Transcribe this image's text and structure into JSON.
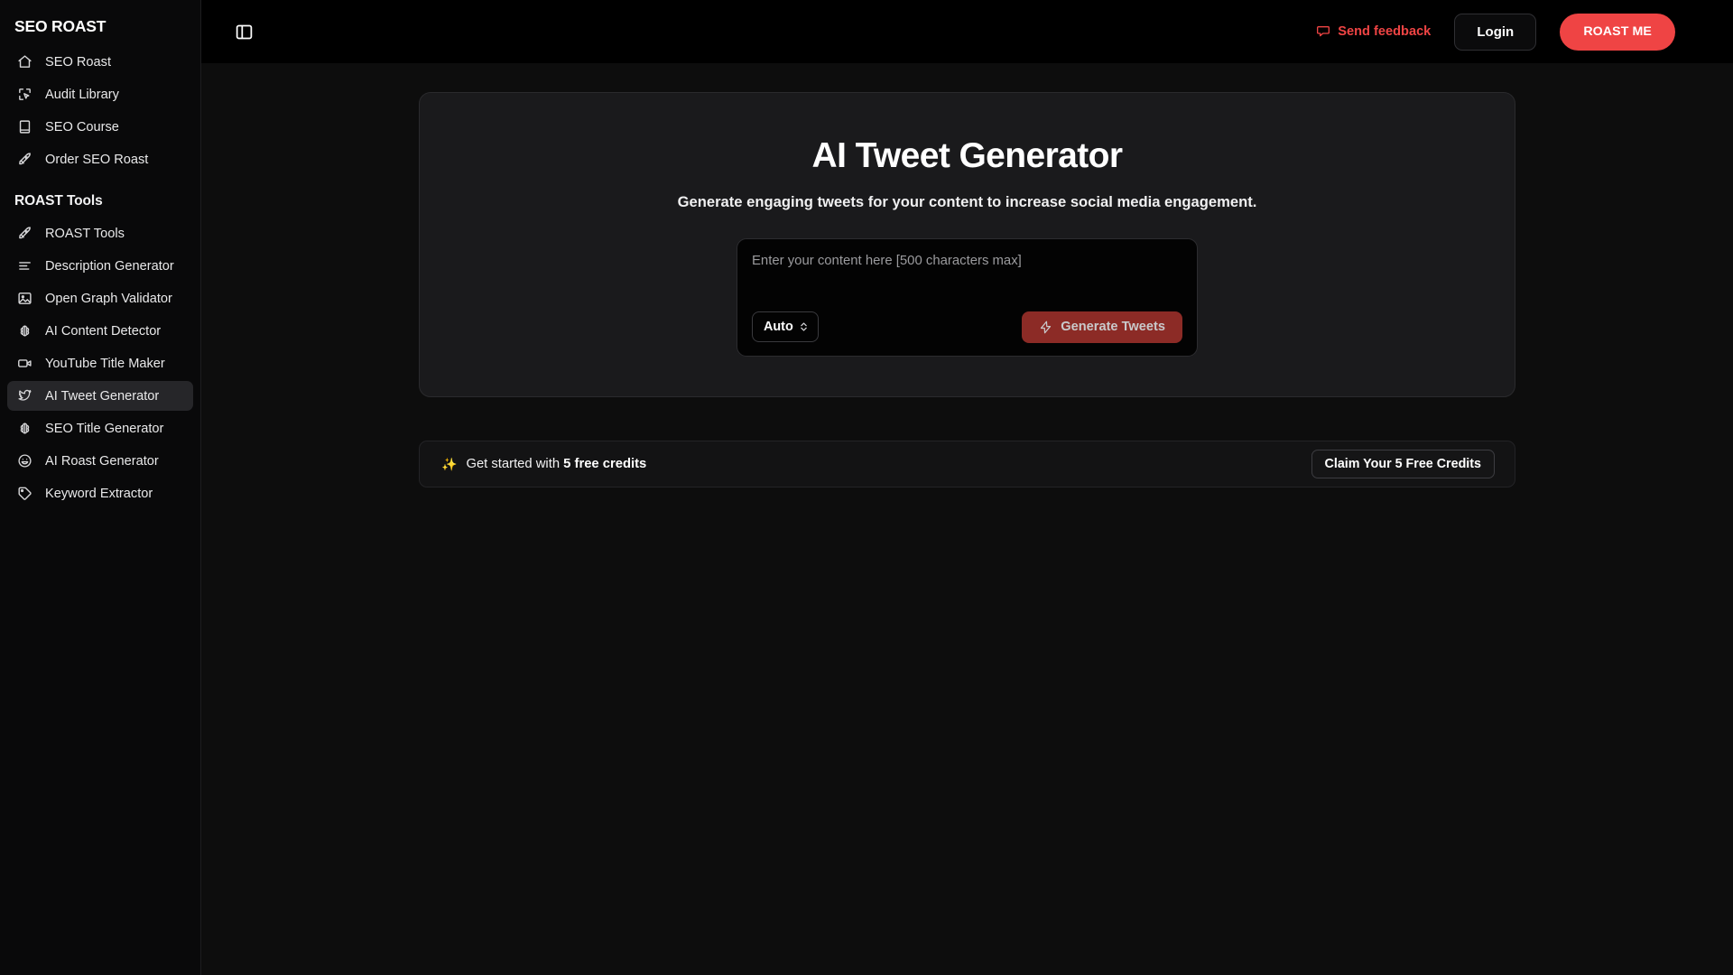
{
  "sidebar": {
    "brand": "SEO ROAST",
    "primary_items": [
      {
        "label": "SEO Roast",
        "icon": "home-icon"
      },
      {
        "label": "Audit Library",
        "icon": "cursor-click-icon"
      },
      {
        "label": "SEO Course",
        "icon": "book-icon"
      },
      {
        "label": "Order SEO Roast",
        "icon": "rocket-icon"
      }
    ],
    "tools_section_title": "ROAST Tools",
    "tool_items": [
      {
        "label": "ROAST Tools",
        "icon": "rocket-icon",
        "active": false
      },
      {
        "label": "Description Generator",
        "icon": "align-left-icon",
        "active": false
      },
      {
        "label": "Open Graph Validator",
        "icon": "image-icon",
        "active": false
      },
      {
        "label": "AI Content Detector",
        "icon": "brain-icon",
        "active": false
      },
      {
        "label": "YouTube Title Maker",
        "icon": "video-icon",
        "active": false
      },
      {
        "label": "AI Tweet Generator",
        "icon": "twitter-bird-icon",
        "active": true
      },
      {
        "label": "SEO Title Generator",
        "icon": "brain-icon",
        "active": false
      },
      {
        "label": "AI Roast Generator",
        "icon": "smile-icon",
        "active": false
      },
      {
        "label": "Keyword Extractor",
        "icon": "tag-icon",
        "active": false
      }
    ]
  },
  "topbar": {
    "panel_toggle_icon": "sidebar-toggle-icon",
    "feedback_label": "Send feedback",
    "feedback_icon": "message-icon",
    "login_label": "Login",
    "roast_me_label": "ROAST ME",
    "accent_red": "#ef4444"
  },
  "main": {
    "title": "AI Tweet Generator",
    "subtitle": "Generate engaging tweets for your content to increase social media engagement.",
    "composer": {
      "placeholder": "Enter your content here [500 characters max]",
      "value": "",
      "language_selected": "Auto",
      "language_options": [
        "Auto"
      ],
      "generate_label": "Generate Tweets",
      "generate_icon": "lightning-icon",
      "generate_bg": "#8c2b26"
    },
    "credits": {
      "icon": "sparkles-icon",
      "text_prefix": "Get started with ",
      "text_bold": "5 free credits",
      "claim_label": "Claim Your 5 Free Credits"
    }
  }
}
